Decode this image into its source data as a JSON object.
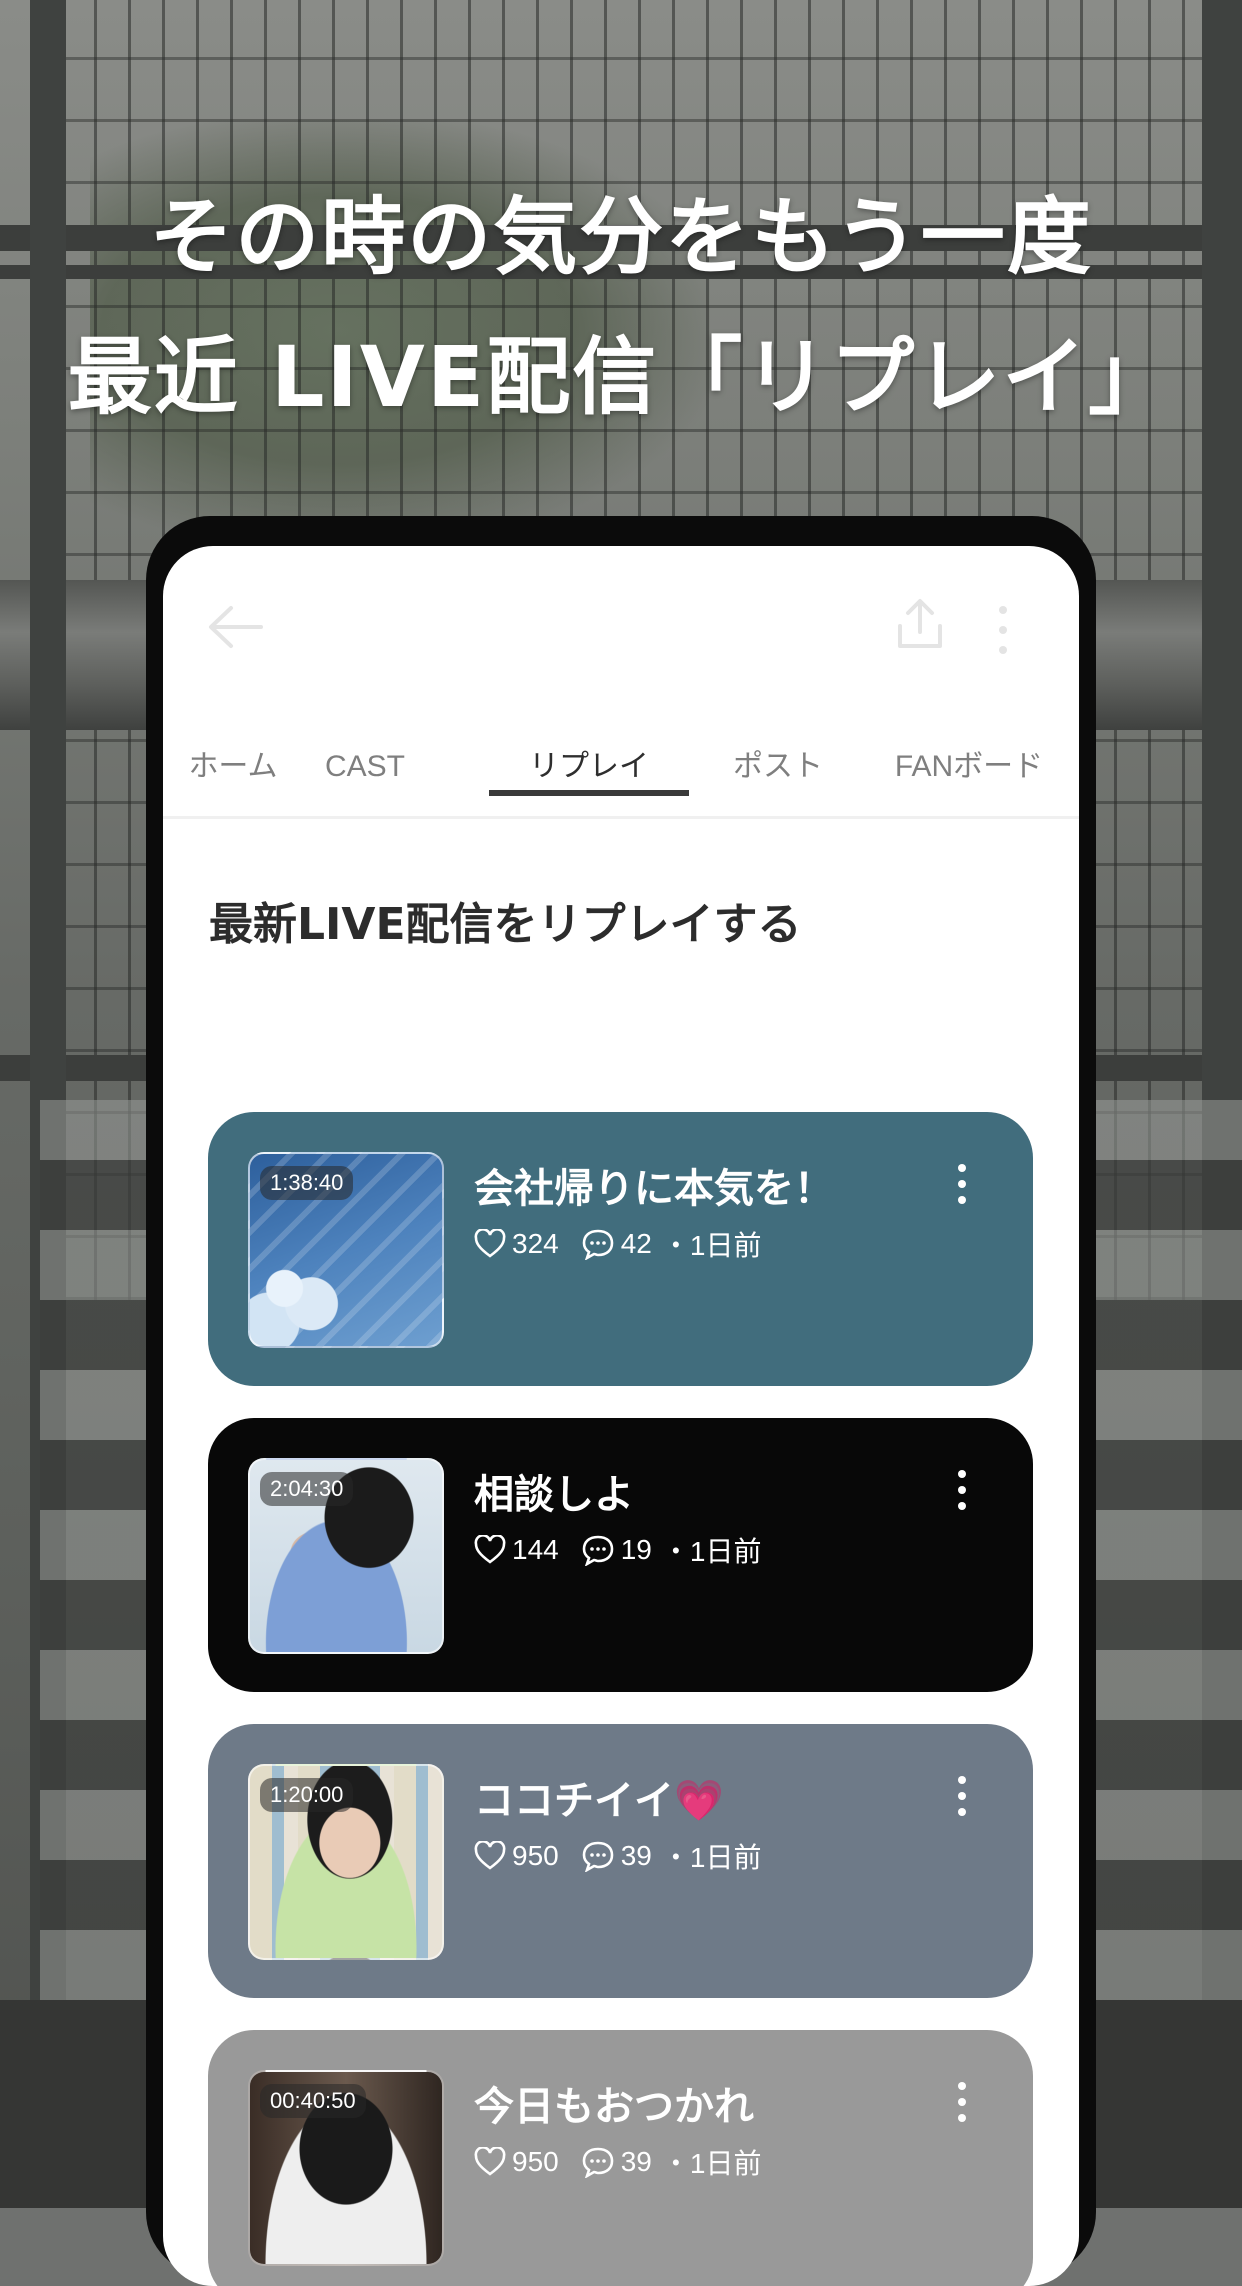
{
  "headline": {
    "line1": "その時の気分をもう一度",
    "line2": "最近 LIVE配信「リプレイ」"
  },
  "topbar": {
    "back_icon": "arrow-left-icon",
    "share_icon": "share-upload-icon",
    "more_icon": "more-vertical-icon"
  },
  "tabs": [
    {
      "label": "ホーム",
      "active": false
    },
    {
      "label": "CAST",
      "active": false
    },
    {
      "label": "リプレイ",
      "active": true
    },
    {
      "label": "ポスト",
      "active": false
    },
    {
      "label": "FANボード",
      "active": false
    }
  ],
  "section": {
    "title": "最新LIVE配信をリプレイする"
  },
  "replays": [
    {
      "duration": "1:38:40",
      "title": "会社帰りに本気を！",
      "likes": "324",
      "comments": "42",
      "time": "・1日前",
      "color": "#416d7d"
    },
    {
      "duration": "2:04:30",
      "title": "相談しよ",
      "likes": "144",
      "comments": "19",
      "time": "・1日前",
      "color": "#080808"
    },
    {
      "duration": "1:20:00",
      "title": "ココチイイ💗",
      "likes": "950",
      "comments": "39",
      "time": "・1日前",
      "color": "#6e7a88"
    },
    {
      "duration": "00:40:50",
      "title": "今日もおつかれ",
      "likes": "950",
      "comments": "39",
      "time": "・1日前",
      "color": "#999999"
    }
  ],
  "icons": {
    "like": "heart-icon",
    "comment": "comment-bubble-icon",
    "menu": "more-vertical-icon"
  }
}
